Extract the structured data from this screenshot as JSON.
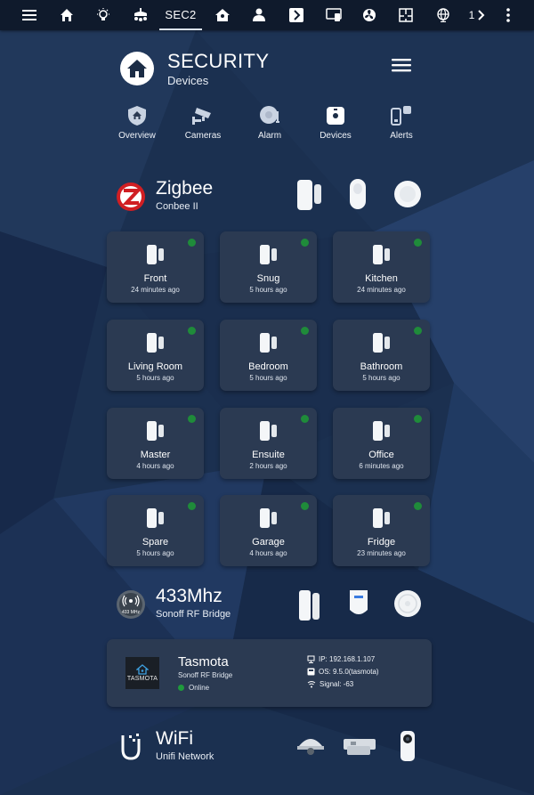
{
  "topbar": {
    "tabs": [
      {
        "name": "menu-icon"
      },
      {
        "name": "home-icon"
      },
      {
        "name": "lightbulb-icon"
      },
      {
        "name": "ceiling-light-icon"
      },
      {
        "name": "sec2",
        "label": "SEC2",
        "active": true
      },
      {
        "name": "house-network-icon"
      },
      {
        "name": "person-icon"
      },
      {
        "name": "chevron-box-icon"
      },
      {
        "name": "remote-screen-icon"
      },
      {
        "name": "fan-icon"
      },
      {
        "name": "floorplan-icon"
      },
      {
        "name": "globe-icon"
      }
    ],
    "page_label": "1",
    "more_icon": "dots-vertical-icon"
  },
  "header": {
    "title": "SECURITY",
    "subtitle": "Devices"
  },
  "nav": [
    {
      "label": "Overview",
      "icon": "shield-home-icon"
    },
    {
      "label": "Cameras",
      "icon": "cctv-icon"
    },
    {
      "label": "Alarm",
      "icon": "bell-icon"
    },
    {
      "label": "Devices",
      "icon": "device-icon"
    },
    {
      "label": "Alerts",
      "icon": "alert-icon"
    }
  ],
  "zigbee": {
    "title": "Zigbee",
    "subtitle": "Conbee II",
    "sensors": [
      {
        "name": "Front",
        "time": "24 minutes ago"
      },
      {
        "name": "Snug",
        "time": "5 hours ago"
      },
      {
        "name": "Kitchen",
        "time": "24 minutes ago"
      },
      {
        "name": "Living Room",
        "time": "5 hours ago"
      },
      {
        "name": "Bedroom",
        "time": "5 hours ago"
      },
      {
        "name": "Bathroom",
        "time": "5 hours ago"
      },
      {
        "name": "Master",
        "time": "4 hours ago"
      },
      {
        "name": "Ensuite",
        "time": "2 hours ago"
      },
      {
        "name": "Office",
        "time": "6 minutes ago"
      },
      {
        "name": "Spare",
        "time": "5 hours ago"
      },
      {
        "name": "Garage",
        "time": "4 hours ago"
      },
      {
        "name": "Fridge",
        "time": "23 minutes ago"
      }
    ]
  },
  "rf": {
    "title": "433Mhz",
    "subtitle": "Sonoff RF Bridge",
    "logo_text": "433 MHz"
  },
  "tasmota": {
    "name": "Tasmota",
    "device": "Sonoff RF Bridge",
    "status": "Online",
    "logo_text": "TASMOTA",
    "ip": "IP: 192.168.1.107",
    "os": "OS: 9.5.0(tasmota)",
    "signal": "Signal: -63"
  },
  "wifi": {
    "title": "WiFi",
    "subtitle": "Unifi Network"
  },
  "colors": {
    "topbar": "#0f1a2c",
    "tile": "#2b3a52",
    "online": "#1f8b3a",
    "zigbee": "#d01e23"
  }
}
